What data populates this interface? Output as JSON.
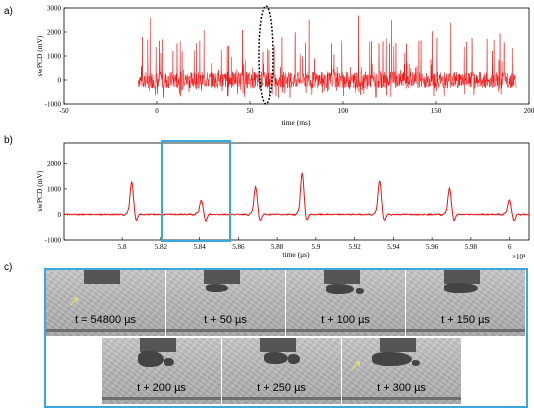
{
  "panels": {
    "a": "a)",
    "b": "b)",
    "c": "c)"
  },
  "colors": {
    "signal": "#ee1111",
    "box": "#3aa8dc",
    "ellipse": "#000000"
  },
  "chart_data": [
    {
      "type": "line",
      "ylabel": "swPCD (mV)",
      "xlabel": "time (ms)",
      "xlim": [
        -50,
        200
      ],
      "ylim": [
        -1000,
        3000
      ],
      "xticks": [
        "-50",
        "0",
        "50",
        "100",
        "150",
        "200"
      ],
      "yticks": [
        "-1000",
        "0",
        "1000",
        "2000",
        "3000"
      ],
      "series": [
        {
          "x_range": [
            -10,
            193
          ],
          "baseline": 0,
          "noise_band": [
            -800,
            1000
          ],
          "peaks_max": 2750
        }
      ],
      "annotation": "dotted ellipse near t = 60 ms"
    },
    {
      "type": "line",
      "ylabel": "swPCD (mV)",
      "xlabel": "time (μs)",
      "x_multiplier": "×10⁴",
      "xlim": [
        5.77,
        6.01
      ],
      "ylim": [
        -1000,
        2800
      ],
      "xticks": [
        "5.8",
        "5.82",
        "5.84",
        "5.86",
        "5.88",
        "5.9",
        "5.92",
        "5.94",
        "5.96",
        "5.98",
        "6"
      ],
      "yticks": [
        "-1000",
        "0",
        "1000",
        "2000"
      ],
      "series": [
        {
          "peaks": [
            [
              5.805,
              1300
            ],
            [
              5.841,
              600
            ],
            [
              5.869,
              1100
            ],
            [
              5.893,
              1650
            ],
            [
              5.933,
              1350
            ],
            [
              5.969,
              1050
            ],
            [
              6.0,
              600
            ]
          ]
        }
      ],
      "highlight_box": [
        5.84,
        5.87
      ]
    }
  ],
  "frames": [
    {
      "label": "t = 54800 µs",
      "arrow": true
    },
    {
      "label": "t + 50 µs",
      "arrow": false
    },
    {
      "label": "t + 100 µs",
      "arrow": false
    },
    {
      "label": "t + 150 µs",
      "arrow": false
    },
    {
      "label": "t + 200 µs",
      "arrow": false
    },
    {
      "label": "t + 250 µs",
      "arrow": false
    },
    {
      "label": "t + 300 µs",
      "arrow": true
    }
  ]
}
